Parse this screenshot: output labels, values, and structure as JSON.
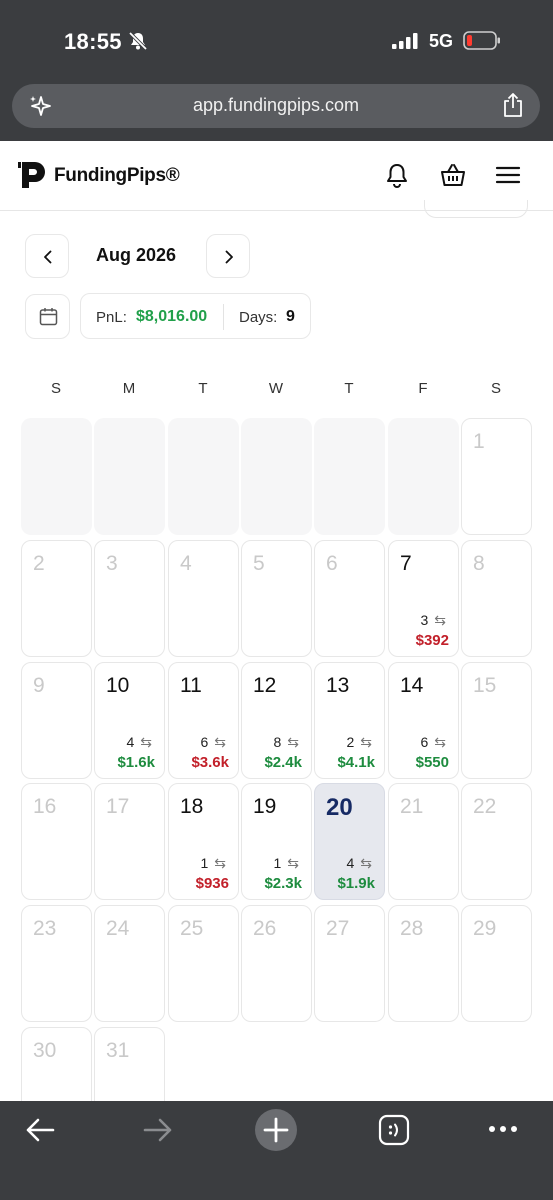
{
  "status_bar": {
    "time": "18:55",
    "network": "5G"
  },
  "browser": {
    "url": "app.fundingpips.com"
  },
  "app": {
    "brand": "FundingPips®"
  },
  "calendar": {
    "month_label": "Aug 2026",
    "pnl_label": "PnL:",
    "pnl_value": "$8,016.00",
    "days_label": "Days:",
    "days_value": "9",
    "weekdays": [
      "S",
      "M",
      "T",
      "W",
      "T",
      "F",
      "S"
    ],
    "today": 20,
    "days": {
      "1": "1",
      "2": "2",
      "3": "3",
      "4": "4",
      "5": "5",
      "6": "6",
      "7": "7",
      "8": "8",
      "9": "9",
      "10": "10",
      "11": "11",
      "12": "12",
      "13": "13",
      "14": "14",
      "15": "15",
      "16": "16",
      "17": "17",
      "18": "18",
      "19": "19",
      "20": "20",
      "21": "21",
      "22": "22",
      "23": "23",
      "24": "24",
      "25": "25",
      "26": "26",
      "27": "27",
      "28": "28",
      "29": "29",
      "30": "30",
      "31": "31"
    },
    "trading_days": {
      "7": {
        "trades": "3",
        "amount": "$392",
        "sign": "neg"
      },
      "10": {
        "trades": "4",
        "amount": "$1.6k",
        "sign": "pos"
      },
      "11": {
        "trades": "6",
        "amount": "$3.6k",
        "sign": "neg"
      },
      "12": {
        "trades": "8",
        "amount": "$2.4k",
        "sign": "pos"
      },
      "13": {
        "trades": "2",
        "amount": "$4.1k",
        "sign": "pos"
      },
      "14": {
        "trades": "6",
        "amount": "$550",
        "sign": "pos"
      },
      "18": {
        "trades": "1",
        "amount": "$936",
        "sign": "neg"
      },
      "19": {
        "trades": "1",
        "amount": "$2.3k",
        "sign": "pos"
      },
      "20": {
        "trades": "4",
        "amount": "$1.9k",
        "sign": "pos"
      }
    },
    "trade_icon": "swap-arrows-icon"
  },
  "colors": {
    "positive": "#1e8c3f",
    "negative": "#c2202a",
    "today_bg": "#e6e8ee",
    "chrome": "#3b3d40"
  }
}
